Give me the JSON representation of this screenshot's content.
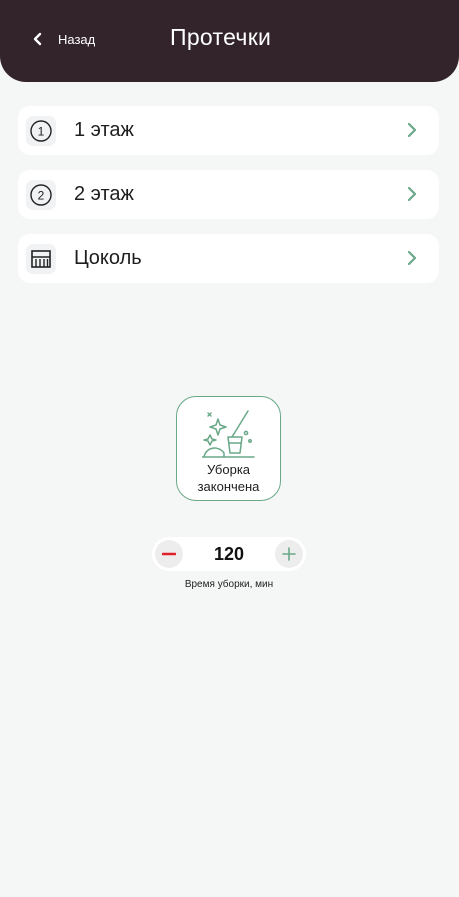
{
  "header": {
    "back_label": "Назад",
    "title": "Протечки"
  },
  "floors": [
    {
      "label": "1 этаж",
      "icon": "circled-one-icon"
    },
    {
      "label": "2 этаж",
      "icon": "circled-two-icon"
    },
    {
      "label": "Цоколь",
      "icon": "basement-icon"
    }
  ],
  "cleaning": {
    "tile_label": "Уборка закончена",
    "value": "120",
    "caption": "Время уборки, мин"
  },
  "colors": {
    "header_bg": "#32242a",
    "accent_green": "#6aa889",
    "minus_red": "#e0202a"
  }
}
